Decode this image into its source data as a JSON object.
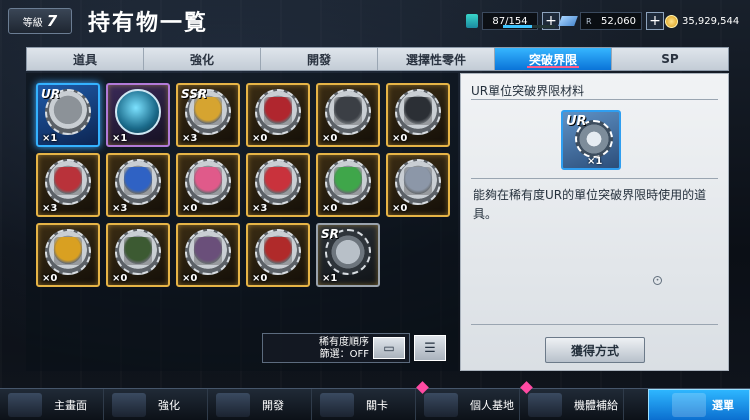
{
  "header": {
    "rank_prefix": "等級",
    "rank_value": "7",
    "title": "持有物一覧",
    "energy": "87/154",
    "energy_fraction": 0.565,
    "gems_prefix": "R",
    "gems": "52,060",
    "coins": "35,929,544",
    "plus": "+"
  },
  "tabs": [
    {
      "label": "道具"
    },
    {
      "label": "強化"
    },
    {
      "label": "開發"
    },
    {
      "label": "選擇性零件"
    },
    {
      "label": "突破界限",
      "active": true
    },
    {
      "label": "SP"
    }
  ],
  "items": [
    {
      "count": "×1",
      "rarity": "UR",
      "type": "ur",
      "figure_color": "#e6ecf2",
      "selected": true
    },
    {
      "count": "×1",
      "rarity": "",
      "type": "globe",
      "figure_color": "#7ce2ff"
    },
    {
      "count": "×3",
      "rarity": "SSR",
      "type": "gold",
      "figure_color": "#d6a430"
    },
    {
      "count": "×0",
      "rarity": "",
      "type": "gold",
      "figure_color": "#b0262e"
    },
    {
      "count": "×0",
      "rarity": "",
      "type": "gold",
      "figure_color": "#3b3f45"
    },
    {
      "count": "×0",
      "rarity": "",
      "type": "gold",
      "figure_color": "#2b2f35"
    },
    {
      "count": "×3",
      "rarity": "",
      "type": "gold",
      "figure_color": "#b9323a"
    },
    {
      "count": "×3",
      "rarity": "",
      "type": "gold",
      "figure_color": "#2f62c4"
    },
    {
      "count": "×0",
      "rarity": "",
      "type": "gold",
      "figure_color": "#e05a8a"
    },
    {
      "count": "×3",
      "rarity": "",
      "type": "gold",
      "figure_color": "#c9323c"
    },
    {
      "count": "×0",
      "rarity": "",
      "type": "gold",
      "figure_color": "#3fa64a"
    },
    {
      "count": "×0",
      "rarity": "",
      "type": "gold",
      "figure_color": "#8c97a8"
    },
    {
      "count": "×0",
      "rarity": "",
      "type": "gold",
      "figure_color": "#d9a021"
    },
    {
      "count": "×0",
      "rarity": "",
      "type": "gold",
      "figure_color": "#3c5a32"
    },
    {
      "count": "×0",
      "rarity": "",
      "type": "gold",
      "figure_color": "#6a4f7a"
    },
    {
      "count": "×0",
      "rarity": "",
      "type": "gold",
      "figure_color": "#b02a2a"
    },
    {
      "count": "×1",
      "rarity": "SR",
      "type": "sr",
      "figure_color": "#c8cdd2"
    }
  ],
  "sort": {
    "order_label": "稀有度順序",
    "filter_label": "篩選：OFF"
  },
  "detail": {
    "title": "UR單位突破界限材料",
    "icon_rarity": "UR",
    "icon_count": "×1",
    "description": "能夠在稀有度UR的單位突破界限時使用的道具。",
    "obtain_label": "獲得方式"
  },
  "bottom_nav": [
    {
      "label": "主畫面",
      "icon": "home-icon"
    },
    {
      "label": "強化",
      "icon": "enhance-icon"
    },
    {
      "label": "開發",
      "icon": "develop-icon"
    },
    {
      "label": "關卡",
      "icon": "stage-icon"
    },
    {
      "label": "個人基地",
      "icon": "base-icon",
      "badge": true
    },
    {
      "label": "機體補給",
      "icon": "supply-icon",
      "badge": true
    },
    {
      "label": "選單",
      "icon": "menu-icon"
    }
  ],
  "colors": {
    "accent": "#0a73d8",
    "ur_border": "#34b2ff",
    "gold_border": "#e6b446",
    "badge": "#ff4aa3"
  }
}
